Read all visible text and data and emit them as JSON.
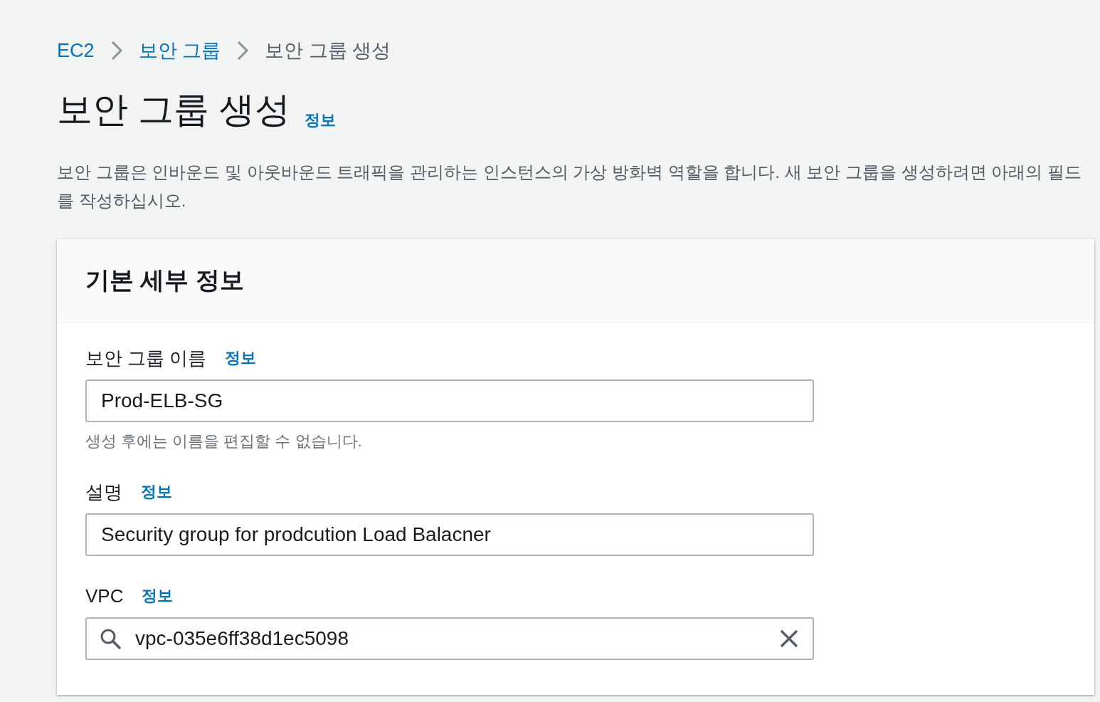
{
  "breadcrumb": [
    {
      "label": "EC2",
      "kind": "link"
    },
    {
      "label": "보안 그룹",
      "kind": "link"
    },
    {
      "label": "보안 그룹 생성",
      "kind": "current"
    }
  ],
  "page": {
    "title": "보안 그룹 생성",
    "info_link": "정보",
    "description": "보안 그룹은 인바운드 및 아웃바운드 트래픽을 관리하는 인스턴스의 가상 방화벽 역할을 합니다. 새 보안 그룹을 생성하려면 아래의 필드를 작성하십시오."
  },
  "panel": {
    "title": "기본 세부 정보",
    "fields": [
      {
        "label": "보안 그룹 이름",
        "info_link": "정보",
        "kind": "text",
        "value": "Prod-ELB-SG",
        "hint": "생성 후에는 이름을 편집할 수 없습니다."
      },
      {
        "label": "설명",
        "info_link": "정보",
        "kind": "text",
        "value": "Security group for prodcution Load Balacner"
      },
      {
        "label": "VPC",
        "info_link": "정보",
        "kind": "search",
        "value": "vpc-035e6ff38d1ec5098"
      }
    ]
  }
}
